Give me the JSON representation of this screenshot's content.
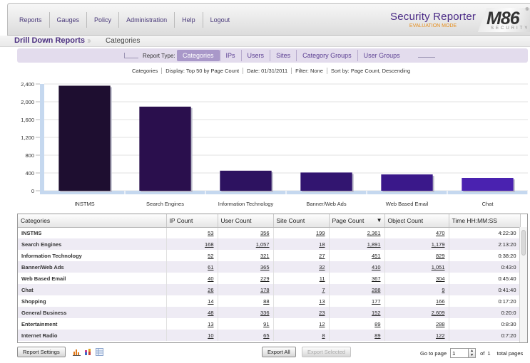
{
  "nav": {
    "items": [
      "Reports",
      "Gauges",
      "Policy",
      "Administration",
      "Help",
      "Logout"
    ]
  },
  "brand": {
    "title": "Security Reporter",
    "subtitle": "EVALUATION MODE",
    "logo": "M86",
    "logo_sub": "SECURITY",
    "reg": "®"
  },
  "breadcrumb": {
    "root": "Drill Down Reports",
    "current": "Categories"
  },
  "report_type": {
    "label": "Report Type:",
    "tabs": [
      "Categories",
      "IPs",
      "Users",
      "Sites",
      "Category Groups",
      "User Groups"
    ],
    "active": 0
  },
  "filter_info": {
    "items": [
      "Categories",
      "Display: Top 50 by Page Count",
      "Date: 01/31/2011",
      "Filter: None",
      "Sort by: Page Count, Descending"
    ]
  },
  "chart_data": {
    "type": "bar",
    "categories": [
      "INSTMS",
      "Search Engines",
      "Information Technology",
      "Banner/Web Ads",
      "Web Based Email",
      "Chat"
    ],
    "values": [
      2361,
      1891,
      451,
      410,
      367,
      288
    ],
    "ylim": [
      0,
      2400
    ],
    "yticks": [
      "0",
      "400",
      "800",
      "1,200",
      "1,600",
      "2,000",
      "2,400"
    ],
    "grid": true,
    "colors": [
      "#1e0e30",
      "#2a0f4d",
      "#2d1260",
      "#321570",
      "#3a188a",
      "#4a22b0"
    ]
  },
  "table": {
    "columns": [
      "Categories",
      "IP Count",
      "User Count",
      "Site Count",
      "Page Count",
      "Object Count",
      "Time HH:MM:SS"
    ],
    "sort_indicator": "▼",
    "rows": [
      [
        "INSTMS",
        "53",
        "356",
        "199",
        "2,361",
        "470",
        "4:22:30"
      ],
      [
        "Search Engines",
        "168",
        "1,057",
        "18",
        "1,891",
        "1,179",
        "2:13:20"
      ],
      [
        "Information Technology",
        "52",
        "321",
        "27",
        "451",
        "829",
        "0:38:20"
      ],
      [
        "Banner/Web Ads",
        "61",
        "365",
        "32",
        "410",
        "1,051",
        "0:43:0"
      ],
      [
        "Web Based Email",
        "40",
        "229",
        "11",
        "367",
        "304",
        "0:45:40"
      ],
      [
        "Chat",
        "26",
        "178",
        "7",
        "288",
        "9",
        "0:41:40"
      ],
      [
        "Shopping",
        "14",
        "88",
        "13",
        "177",
        "166",
        "0:17:20"
      ],
      [
        "General Business",
        "48",
        "336",
        "23",
        "152",
        "2,609",
        "0:20:0"
      ],
      [
        "Entertainment",
        "13",
        "91",
        "12",
        "89",
        "288",
        "0:8:30"
      ],
      [
        "Internet Radio",
        "10",
        "65",
        "8",
        "89",
        "122",
        "0:7:20"
      ]
    ]
  },
  "footer": {
    "report_settings": "Report Settings",
    "export_all": "Export All",
    "export_selected": "Export Selected",
    "goto_label": "Go to page",
    "page": "1",
    "of_label": "of",
    "total": "1",
    "total_label": "total pages"
  }
}
